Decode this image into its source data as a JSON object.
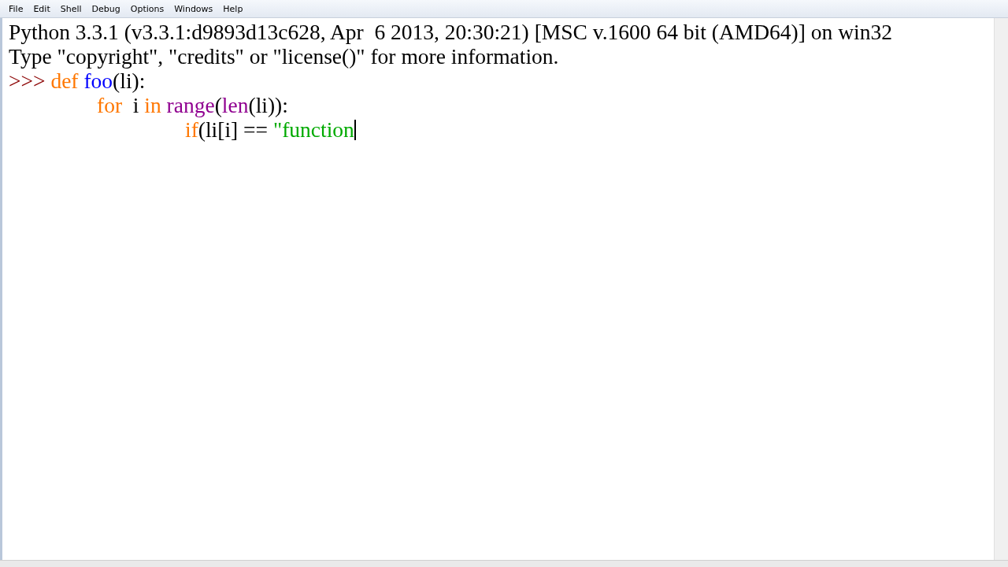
{
  "menu": [
    "File",
    "Edit",
    "Shell",
    "Debug",
    "Options",
    "Windows",
    "Help"
  ],
  "lines": [
    {
      "tokens": [
        {
          "kind": "plain",
          "text": "Python 3.3.1 (v3.3.1:d9893d13c628, Apr  6 2013, 20:30:21) [MSC v.1600 64 bit (AMD64)] on win32"
        }
      ],
      "cursor": false
    },
    {
      "tokens": [
        {
          "kind": "plain",
          "text": "Type \"copyright\", \"credits\" or \"license()\" for more information."
        }
      ],
      "cursor": false
    },
    {
      "tokens": [
        {
          "kind": "prompt",
          "text": ">>> "
        },
        {
          "kind": "keyword",
          "text": "def "
        },
        {
          "kind": "definition",
          "text": "foo"
        },
        {
          "kind": "plain",
          "text": "(li):"
        }
      ],
      "cursor": false,
      "children": [
        {
          "tokens": [
            {
              "kind": "keyword",
              "text": "for"
            },
            {
              "kind": "plain",
              "text": "  i "
            },
            {
              "kind": "keyword",
              "text": "in "
            },
            {
              "kind": "builtin",
              "text": "range"
            },
            {
              "kind": "plain",
              "text": "("
            },
            {
              "kind": "builtin",
              "text": "len"
            },
            {
              "kind": "plain",
              "text": "(li)):"
            }
          ],
          "cursor": false,
          "children": [
            {
              "tokens": [
                {
                  "kind": "keyword",
                  "text": "if"
                },
                {
                  "kind": "plain",
                  "text": "(li[i] == "
                },
                {
                  "kind": "string",
                  "text": "\"function"
                }
              ],
              "cursor": true
            }
          ]
        }
      ]
    }
  ]
}
